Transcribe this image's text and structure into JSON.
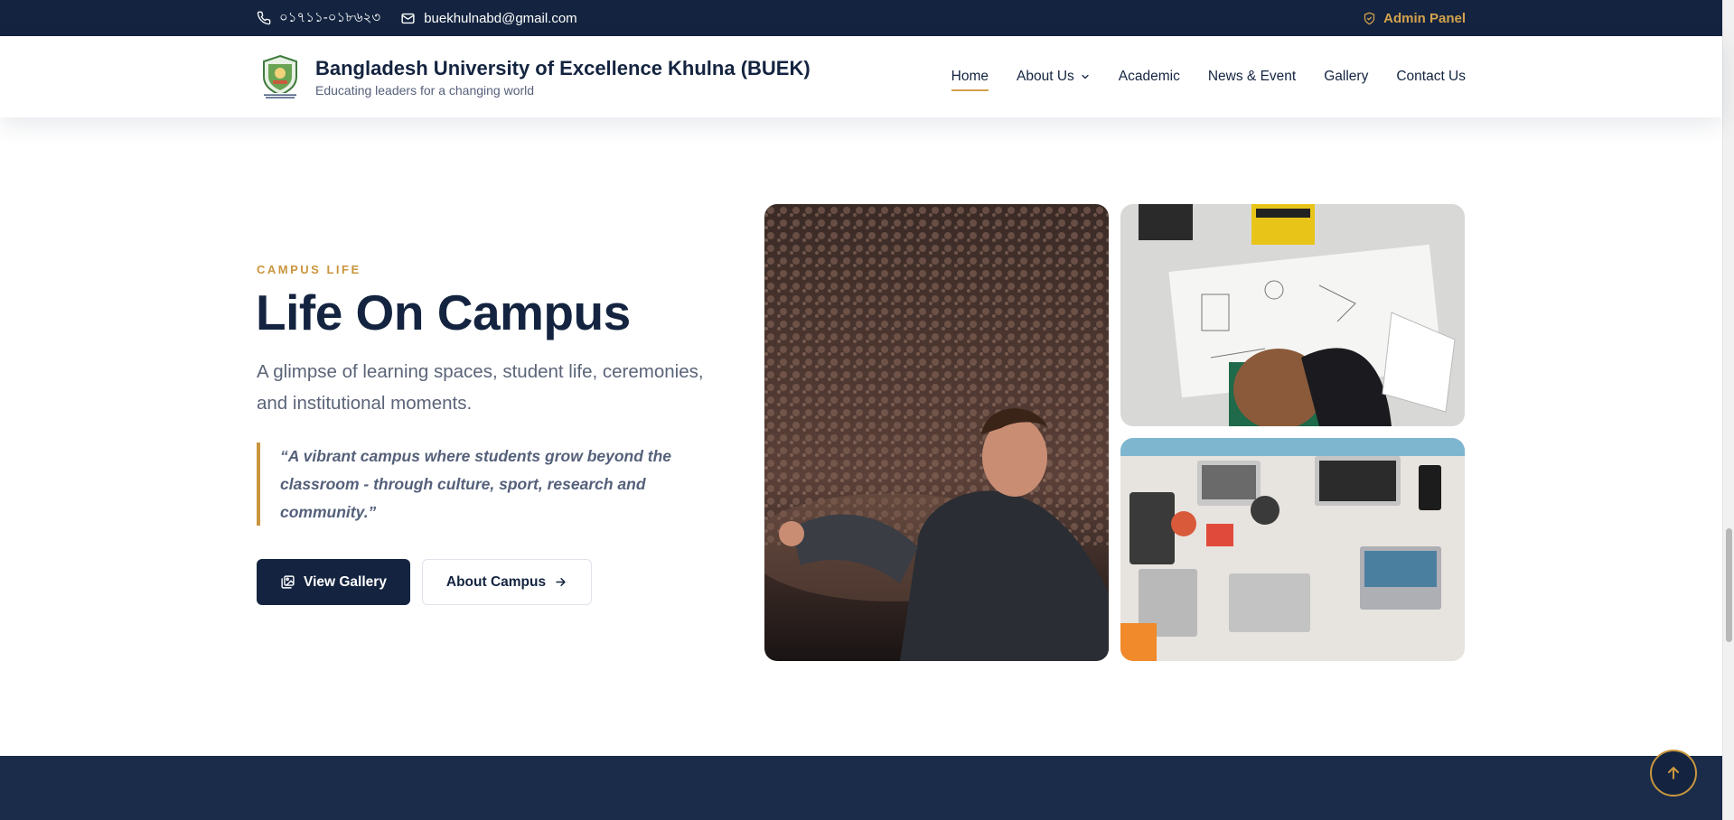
{
  "topbar": {
    "phone": "০১৭১১-০১৮৬২৩",
    "email": "buekhulnabd@gmail.com",
    "admin_label": "Admin Panel"
  },
  "header": {
    "title": "Bangladesh University of Excellence Khulna (BUEK)",
    "subtitle": "Educating leaders for a changing world",
    "nav": [
      {
        "label": "Home",
        "active": true
      },
      {
        "label": "About Us",
        "dropdown": true
      },
      {
        "label": "Academic"
      },
      {
        "label": "News & Event"
      },
      {
        "label": "Gallery"
      },
      {
        "label": "Contact Us"
      }
    ]
  },
  "campus": {
    "eyebrow": "CAMPUS LIFE",
    "title": "Life On Campus",
    "description": "A glimpse of learning spaces, student life, ceremonies, and institutional moments.",
    "quote": "“A vibrant campus where students grow beyond the classroom - through culture, sport, research and community.”",
    "primary_button": "View Gallery",
    "secondary_button": "About Campus"
  },
  "colors": {
    "navy": "#142440",
    "gold": "#c9963e",
    "muted_text": "#5b6478"
  },
  "icons": [
    "phone-icon",
    "mail-icon",
    "shield-icon",
    "chevron-down-icon",
    "gallery-icon",
    "arrow-right-icon",
    "arrow-up-icon"
  ]
}
